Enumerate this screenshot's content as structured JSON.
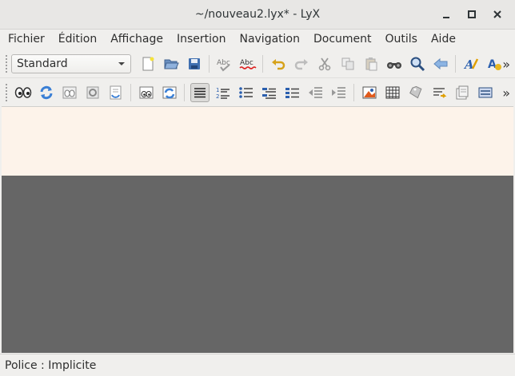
{
  "window": {
    "title": "~/nouveau2.lyx* - LyX"
  },
  "window_controls": [
    {
      "name": "minimize",
      "glyph": "_"
    },
    {
      "name": "maximize",
      "glyph": "□"
    },
    {
      "name": "close",
      "glyph": "✕"
    }
  ],
  "menu": {
    "items": [
      "Fichier",
      "Édition",
      "Affichage",
      "Insertion",
      "Navigation",
      "Document",
      "Outils",
      "Aide"
    ]
  },
  "toolbar1": {
    "layout_select": "Standard",
    "tools": [
      "new-document-icon",
      "open-document-icon",
      "save-icon",
      "spellcheck-icon",
      "spellcheck-continuous-icon",
      "undo-icon",
      "redo-icon",
      "cut-icon",
      "copy-icon",
      "paste-icon",
      "find-icon",
      "find-replace-icon",
      "navigate-back-icon",
      "text-style-icon",
      "paragraph-style-icon"
    ],
    "overflow": "»"
  },
  "toolbar2": {
    "tools": [
      "view-icon",
      "update-icon",
      "view-master-icon",
      "view-other-icon",
      "update-other-icon",
      "view-changes-icon",
      "update-changes-icon",
      "align-justify-icon",
      "numbered-list-icon",
      "bullet-list-icon",
      "description-list-icon",
      "outline-list-icon",
      "decrease-depth-icon",
      "increase-depth-icon",
      "insert-graphics-icon",
      "insert-table-icon",
      "insert-label-icon",
      "insert-crossref-icon",
      "insert-note-icon",
      "toggle-outline-icon"
    ],
    "overflow": "»"
  },
  "status": {
    "text": "Police : Implicite"
  },
  "colors": {
    "editor_background": "#fdf3ea",
    "canvas_background": "#666666",
    "accent_blue": "#3a7fd5"
  }
}
